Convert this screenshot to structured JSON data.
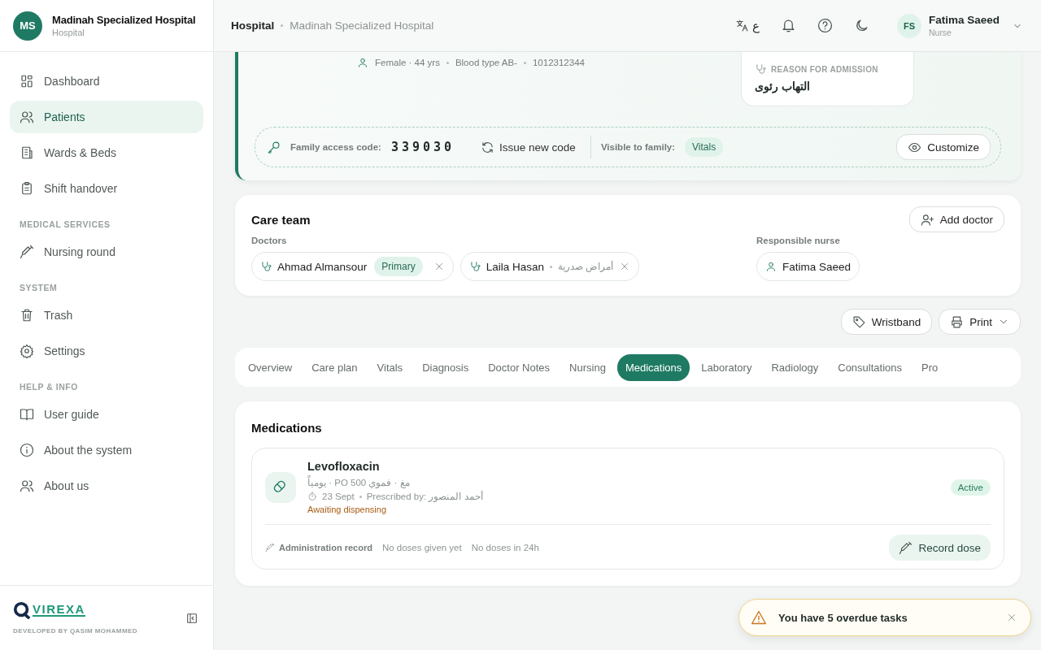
{
  "sidebar": {
    "hospital": {
      "initials": "MS",
      "name": "Madinah Specialized Hospital",
      "subtitle": "Hospital"
    },
    "groups": [
      {
        "items": [
          {
            "label": "Dashboard",
            "selected": false
          },
          {
            "label": "Patients",
            "selected": true
          },
          {
            "label": "Wards & Beds",
            "selected": false
          },
          {
            "label": "Shift handover",
            "selected": false
          }
        ]
      },
      {
        "heading": "MEDICAL SERVICES",
        "items": [
          {
            "label": "Nursing round",
            "selected": false
          }
        ]
      },
      {
        "heading": "SYSTEM",
        "items": [
          {
            "label": "Trash",
            "selected": false
          },
          {
            "label": "Settings",
            "selected": false
          }
        ]
      },
      {
        "heading": "HELP & INFO",
        "items": [
          {
            "label": "User guide",
            "selected": false
          },
          {
            "label": "About the system",
            "selected": false
          },
          {
            "label": "About us",
            "selected": false
          }
        ]
      }
    ],
    "brand": "VIREXA",
    "credit": "DEVELOPED BY QASIM MOHAMMED"
  },
  "header": {
    "breadcrumb": [
      "Hospital",
      "Madinah Specialized Hospital"
    ],
    "language": "ع",
    "user": {
      "initials": "FS",
      "name": "Fatima Saeed",
      "role": "Nurse"
    }
  },
  "patient": {
    "meta": [
      "Female · 44 yrs",
      "Blood type AB-",
      "1012312344"
    ],
    "reason": {
      "label": "REASON FOR ADMISSION",
      "value": "التهاب رئوى"
    },
    "family": {
      "label": "Family access code:",
      "code": "339030",
      "issue": "Issue new code",
      "visible_label": "Visible to family:",
      "chips": [
        "Vitals"
      ],
      "customize": "Customize"
    }
  },
  "care_team": {
    "title": "Care team",
    "add": "Add doctor",
    "doctors_label": "Doctors",
    "doctors": [
      {
        "name": "Ahmad Almansour",
        "badge": "Primary"
      },
      {
        "name": "Laila Hasan",
        "specialty": "أمراض صدرية"
      }
    ],
    "nurse_label": "Responsible nurse",
    "nurse": "Fatima Saeed"
  },
  "actions": {
    "wristband": "Wristband",
    "print": "Print"
  },
  "tabs": [
    {
      "label": "Overview",
      "selected": false
    },
    {
      "label": "Care plan",
      "selected": false
    },
    {
      "label": "Vitals",
      "selected": false
    },
    {
      "label": "Diagnosis",
      "selected": false
    },
    {
      "label": "Doctor Notes",
      "selected": false
    },
    {
      "label": "Nursing",
      "selected": false
    },
    {
      "label": "Medications",
      "selected": true
    },
    {
      "label": "Laboratory",
      "selected": false
    },
    {
      "label": "Radiology",
      "selected": false
    },
    {
      "label": "Consultations",
      "selected": false
    },
    {
      "label": "Pro",
      "selected": false
    }
  ],
  "medications": {
    "title": "Medications",
    "items": [
      {
        "name": "Levofloxacin",
        "dose": "يومياً · PO مغ · فموي 500",
        "date": "23 Sept",
        "prescribed": "Prescribed by: أحمد المنصور",
        "status": "Awaiting dispensing",
        "badge": "Active",
        "record_label": "Administration record",
        "given": "No doses given yet",
        "last24": "No doses in 24h",
        "action": "Record dose"
      }
    ]
  },
  "toast": {
    "message": "You have 5 overdue tasks"
  }
}
